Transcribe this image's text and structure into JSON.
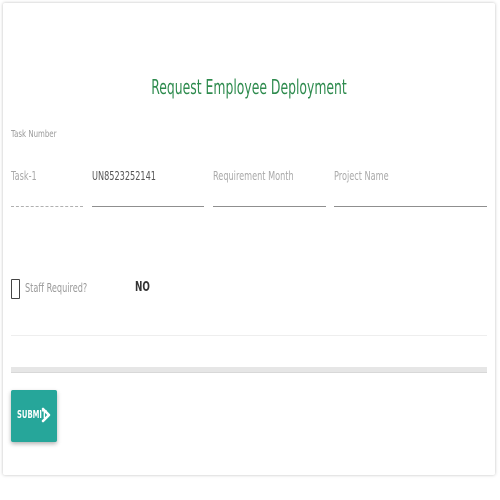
{
  "form": {
    "title": "Request Employee Deployment",
    "task_number_label": "Task Number"
  },
  "fields": {
    "task": {
      "value": "Task-1"
    },
    "id": {
      "value": "UN8523252141"
    },
    "requirement_month": {
      "placeholder": "Requirement Month"
    },
    "project_name": {
      "placeholder": "Project Name"
    }
  },
  "staff": {
    "label": "Staff Required?",
    "value": "NO",
    "checked": false
  },
  "actions": {
    "submit_label": "SUBMIT",
    "submit_icon": "chevron-right-icon",
    "submit_color": "#26a69a"
  },
  "colors": {
    "title": "#2e8b4e"
  }
}
